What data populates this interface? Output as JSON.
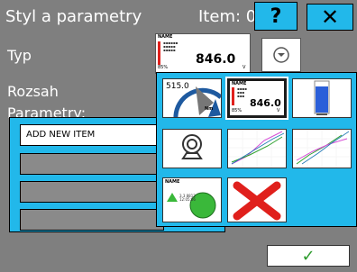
{
  "header": {
    "title": "Styl a parametry",
    "item_label": "Item: 0",
    "help_label": "?",
    "close_label": "✕"
  },
  "form": {
    "typ_label": "Typ",
    "rozsah_label": "Rozsah",
    "parametry_label": "Parametry:"
  },
  "typ_preview": {
    "name": "NAME",
    "value": "846.0",
    "unit": "V",
    "percent": "85%"
  },
  "list": {
    "items": [
      "ADD NEW ITEM",
      "",
      "",
      ""
    ]
  },
  "gallery": {
    "tiles": [
      {
        "name": "gauge",
        "value": "515.0",
        "unit": "Nm"
      },
      {
        "name": "bar-value",
        "title": "NAME",
        "value": "846.0",
        "percent": "85%",
        "unit": "V"
      },
      {
        "name": "tank"
      },
      {
        "name": "webcam"
      },
      {
        "name": "line-chart-1"
      },
      {
        "name": "line-chart-2"
      },
      {
        "name": "status-circle",
        "title": "NAME",
        "sub": "3.3 8812\n12:05:06"
      },
      {
        "name": "delete"
      }
    ]
  },
  "ok_label": "✓",
  "colors": {
    "accent": "#22b8ea",
    "background": "#7f7f7f",
    "ok": "#2d9b2d",
    "delete": "#e0201c"
  }
}
